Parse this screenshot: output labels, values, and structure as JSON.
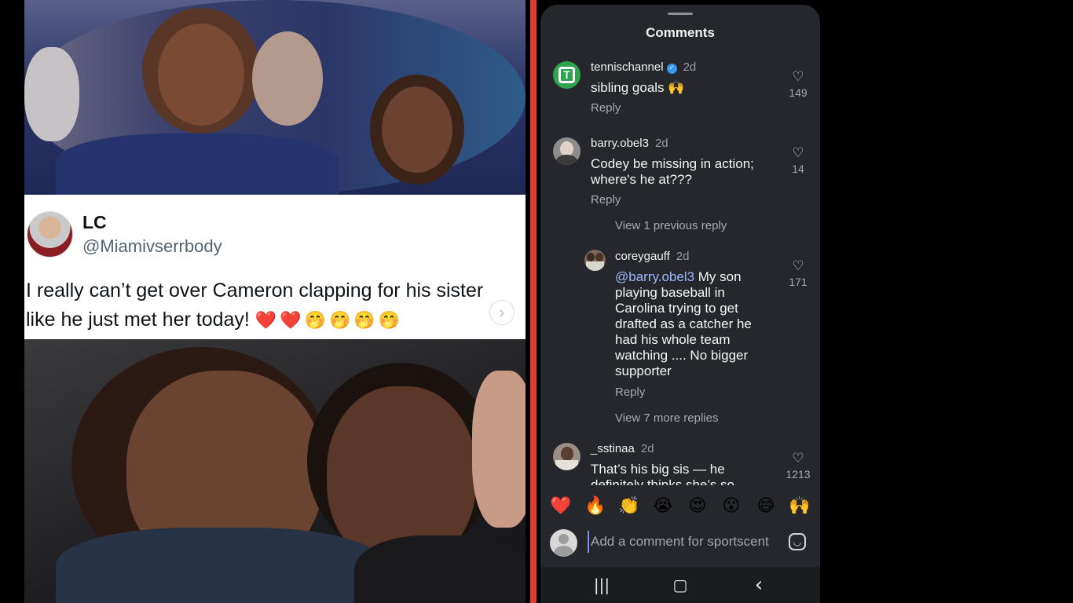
{
  "post": {
    "tweet": {
      "name": "LC",
      "handle": "@Miamivserrbody",
      "text": "I really can’t get over Cameron clapping for his sister like he just met her today!",
      "emojis": "❤️❤️🤭🤭🤭🤭"
    },
    "carousel_next_icon": "›"
  },
  "sheet": {
    "title": "Comments",
    "comments": [
      {
        "user": "tennischannel",
        "verified": true,
        "age": "2d",
        "text": "sibling goals 🙌",
        "reply_label": "Reply",
        "likes": "149"
      },
      {
        "user": "barry.obel3",
        "age": "2d",
        "text": "Codey be missing in action; where's he at???",
        "reply_label": "Reply",
        "likes": "14",
        "view_previous": "View 1 previous reply",
        "reply": {
          "user": "coreygauff",
          "age": "2d",
          "mention": "@barry.obel3",
          "text": " My son playing baseball in Carolina trying to get drafted as a catcher he had his whole team watching .... No bigger supporter",
          "reply_label": "Reply",
          "likes": "171"
        },
        "view_more": "View 7 more replies"
      },
      {
        "user": "_sstinaa",
        "age": "2d",
        "text": "That’s his big sis — he definitely thinks she’s so",
        "likes": "1213"
      }
    ],
    "emoji_reactions": [
      "❤️",
      "🔥",
      "👏",
      "😭",
      "😍",
      "😮",
      "😄",
      "🙌"
    ],
    "input": {
      "placeholder": "Add a comment for sportscent"
    },
    "icons": {
      "like": "heart-outline-icon",
      "sticker": "sticker-icon"
    }
  },
  "nav": {
    "recents": "|||",
    "home": "▢",
    "back": "‹"
  },
  "colors": {
    "accent_divider": "#e23a2e",
    "sheet_bg": "#25272d",
    "mention": "#9fb7ff"
  }
}
